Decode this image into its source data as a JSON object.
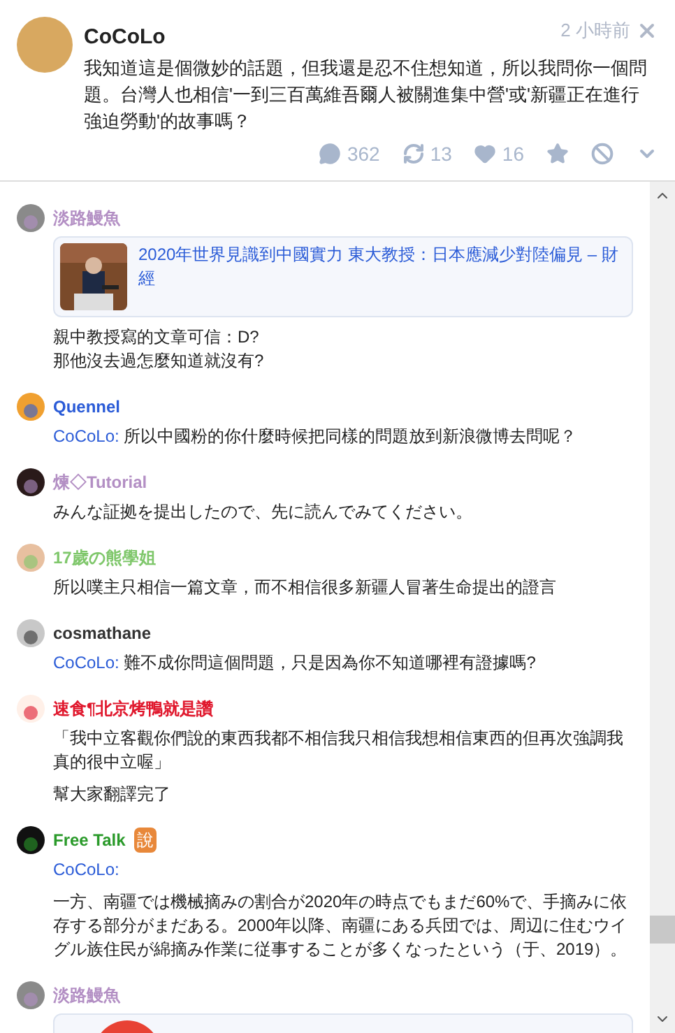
{
  "post": {
    "author": "CoCoLo",
    "time": "2 小時前",
    "text": "我知道這是個微妙的話題，但我還是忍不住想知道，所以我問你一個問題。台灣人也相信'一到三百萬維吾爾人被關進集中營'或'新疆正在進行強迫勞動'的故事嗎？",
    "stats": [
      {
        "kind": "comment",
        "count": "362"
      },
      {
        "kind": "replurk",
        "count": "13"
      },
      {
        "kind": "like",
        "count": "16"
      },
      {
        "kind": "star"
      },
      {
        "kind": "mute"
      },
      {
        "kind": "more"
      }
    ]
  },
  "responses": [
    {
      "author": "淡路鰻魚",
      "color": "#b38fc4",
      "link": {
        "title": "2020年世界見識到中國實力 東大教授：日本應減少對陸偏見 – 財經",
        "kind": "picture"
      },
      "paragraphs": [
        "親中教授寫的文章可信：D?\n那他沒去過怎麼知道就沒有?"
      ]
    },
    {
      "author": "Quennel",
      "color": "#2a5bd7",
      "reply_to": "CoCoLo:",
      "paragraphs": [
        "所以中國粉的你什麼時候把同樣的問題放到新浪微博去問呢？"
      ]
    },
    {
      "author": "煉◇Tutorial",
      "color": "#b38fc4",
      "paragraphs": [
        "みんな証拠を提出したので、先に読んでみてください。"
      ]
    },
    {
      "author": "17歲の熊學姐",
      "color": "#7fc76b",
      "paragraphs": [
        "所以噗主只相信一篇文章，而不相信很多新疆人冒著生命提出的證言"
      ]
    },
    {
      "author": "cosmathane",
      "color": "#333333",
      "reply_to": "CoCoLo:",
      "paragraphs": [
        "難不成你問這個問題，只是因為你不知道哪裡有證據嗎?"
      ]
    },
    {
      "author": "速食¶北京烤鴨就是讚",
      "color": "#e0182d",
      "paragraphs": [
        "「我中立客觀你們說的東西我都不相信我只相信我想相信東西的但再次強調我真的很中立喔」",
        "幫大家翻譯完了"
      ]
    },
    {
      "author": "Free Talk",
      "color": "#2a9a2a",
      "badge": "說",
      "reply_to": "CoCoLo:",
      "reply_own_line": true,
      "paragraphs": [
        "一方、南疆では機械摘みの割合が2020年の時点でもまだ60%で、手摘みに依存する部分がまだある。2000年以降、南疆にある兵団では、周辺に住むウイグル族住民が綿摘み作業に従事することが多くなったという（于、2019）。"
      ]
    },
    {
      "author": "淡路鰻魚",
      "color": "#b38fc4",
      "link": {
        "kind": "partial"
      }
    }
  ]
}
